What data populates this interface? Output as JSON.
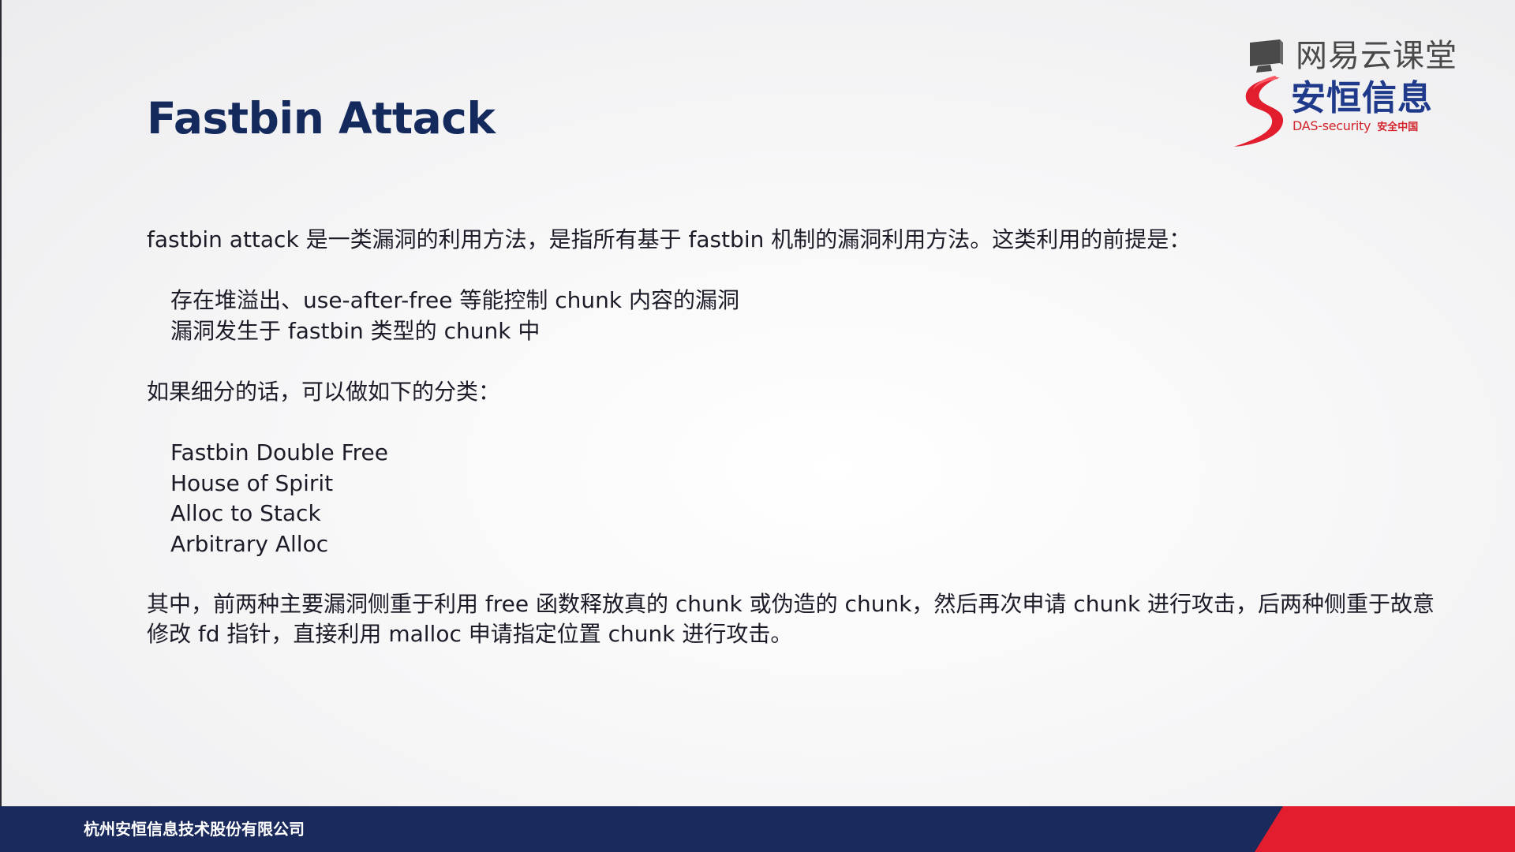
{
  "slide": {
    "title": "Fastbin Attack",
    "intro": "fastbin attack 是一类漏洞的利用方法，是指所有基于 fastbin 机制的漏洞利用方法。这类利用的前提是：",
    "premises": [
      "存在堆溢出、use-after-free 等能控制 chunk 内容的漏洞",
      "漏洞发生于 fastbin 类型的 chunk 中"
    ],
    "subdivision_intro": "如果细分的话，可以做如下的分类：",
    "categories": [
      "Fastbin Double Free",
      "House of Spirit",
      "Alloc to Stack",
      "Arbitrary Alloc"
    ],
    "conclusion": "其中，前两种主要漏洞侧重于利用 free 函数释放真的 chunk 或伪造的 chunk，然后再次申请 chunk 进行攻击，后两种侧重于故意修改 fd 指针，直接利用 malloc 申请指定位置 chunk 进行攻击。"
  },
  "logo": {
    "platform": "网易云课堂",
    "company_cn": "安恒信息",
    "company_en": "DAS-security",
    "tagline": "安全中国",
    "icons": [
      "screen-icon",
      "swirl-logo-icon"
    ]
  },
  "footer": {
    "company": "杭州安恒信息技术股份有限公司"
  },
  "colors": {
    "title": "#152a5c",
    "footer_blue": "#1a2a5c",
    "footer_red": "#e11d2e",
    "brand_blue": "#1f3a8a",
    "brand_red": "#d2232a"
  }
}
